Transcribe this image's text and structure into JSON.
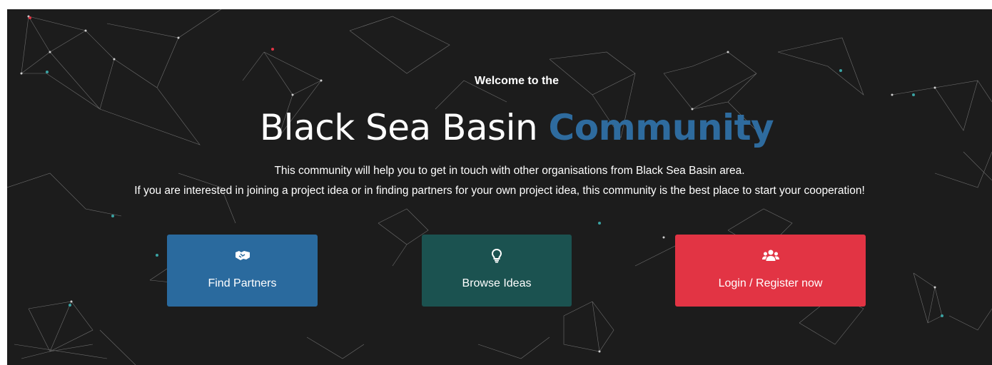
{
  "hero": {
    "welcome": "Welcome to the",
    "title_main": "Black Sea Basin ",
    "title_highlight": "Community",
    "description_line1": "This community will help you to get in touch with other organisations from Black Sea Basin area.",
    "description_line2": "If you are interested in joining a project idea or in finding partners for your own project idea, this community is the best place to start your cooperation!"
  },
  "buttons": {
    "find_partners": {
      "label": "Find Partners",
      "icon": "handshake-icon",
      "color": "#2a6a9e"
    },
    "browse_ideas": {
      "label": "Browse Ideas",
      "icon": "lightbulb-icon",
      "color": "#1b5250"
    },
    "login_register": {
      "label": "Login / Register now",
      "icon": "users-icon",
      "color": "#e23444"
    }
  },
  "colors": {
    "background": "#1c1c1c",
    "accent": "#2e6b9e"
  }
}
